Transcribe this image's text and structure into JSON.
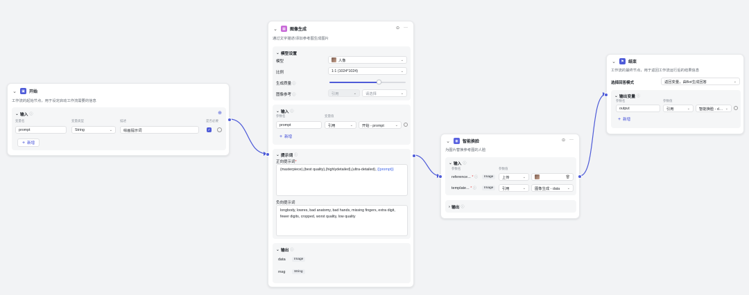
{
  "start_node": {
    "title": "开始",
    "desc": "工作流的起始节点，用于设定启动工作流需要的信息",
    "input_title": "输入",
    "col_var": "变量名",
    "col_type": "变量类型",
    "col_desc": "描述",
    "col_required": "是否必要",
    "row": {
      "name": "prompt",
      "type": "String",
      "desc": "绘画提示词"
    },
    "add_label": "新增"
  },
  "image_node": {
    "title": "图像生成",
    "desc": "通过文字描述/添加参考图生成图片",
    "model_section": "模型设置",
    "model_label": "模型",
    "model_value": "人像",
    "ratio_label": "比例",
    "ratio_value": "1:1 (1024*1024)",
    "quality_label": "生成质量",
    "quality_fraction": 0.65,
    "ref_label": "图像参考",
    "ref_mode": "引用",
    "ref_select": "请选择",
    "input_section": "输入",
    "col_param": "参数名",
    "col_value": "变量值",
    "input_row": {
      "name": "prompt",
      "mode": "引用",
      "value": "开始 - prompt"
    },
    "add_label": "新增",
    "prompt_section": "提示词",
    "positive_label": "正向提示词",
    "positive_text": "(masterpiece),(best quality),(highlydetailed),(ultra-detailed),",
    "positive_var": "{{prompt}}",
    "negative_label": "负向提示词",
    "negative_text": "longbody, lowres, bad anatomy, bad hands, missing fingers, extra digit, fewer digits, cropped, worst quality, low quality",
    "output_section": "输出",
    "outputs": [
      {
        "name": "data",
        "type": "Image"
      },
      {
        "name": "msg",
        "type": "String"
      }
    ]
  },
  "faceswap_node": {
    "title": "智能换脸",
    "desc": "为图片替换参考图的人脸",
    "input_section": "输入",
    "col_param": "参数名",
    "col_value": "参数值",
    "rows": [
      {
        "name": "reference...",
        "required": "*",
        "type": "Image",
        "mode": "上传",
        "value": ""
      },
      {
        "name": "template...",
        "required": "*",
        "type": "Image",
        "mode": "引用",
        "value": "图像生成 - data"
      }
    ],
    "output_section": "输出"
  },
  "end_node": {
    "title": "结束",
    "desc": "工作流的最终节点，用于返回工作流运行后的结果信息",
    "mode_label": "选择回答模式",
    "mode_value": "返回变量，由Bot生成回答",
    "output_section": "输出变量",
    "col_param": "参数名",
    "col_value": "参数值",
    "row": {
      "name": "output",
      "mode": "引用",
      "value": "智能换脸 - data"
    },
    "add_label": "新增"
  },
  "colors": {
    "accent": "#4e5bd8",
    "start_icon": "#4e5bd8",
    "image_icon": "#c86ad7",
    "faceswap_icon": "#5a63e0",
    "end_icon": "#4e5bd8"
  },
  "icons": {
    "collapse": "chevron-down-icon",
    "info": "info-icon",
    "add": "plus-icon",
    "run": "play-icon",
    "more": "more-icon",
    "delete": "trash-icon"
  }
}
